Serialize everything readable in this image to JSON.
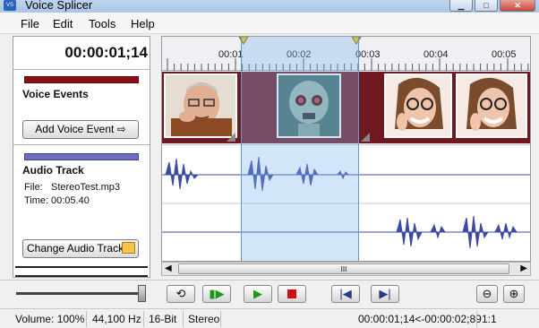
{
  "window": {
    "title": "Voice Splicer",
    "icon_name": "app-icon"
  },
  "menu": [
    "File",
    "Edit",
    "Tools",
    "Help"
  ],
  "left_panel": {
    "timecode": "00:00:01;14",
    "voice_events": {
      "title": "Voice Events",
      "button": "Add Voice Event",
      "button_icon": "arrow-right-icon"
    },
    "audio_track": {
      "title": "Audio Track",
      "file_label": "File:",
      "file_value": "StereoTest.mp3",
      "time_label": "Time:",
      "time_value": "00:05.40",
      "button": "Change Audio Track",
      "button_icon": "folder-icon"
    }
  },
  "timeline": {
    "ruler_labels": [
      "00:01",
      "00:02",
      "00:03",
      "00:04",
      "00:05"
    ],
    "clips": [
      {
        "name": "clip-old-man",
        "icon": "old-man-face"
      },
      {
        "name": "clip-alien",
        "icon": "alien-face"
      },
      {
        "name": "clip-woman-1",
        "icon": "woman-face"
      },
      {
        "name": "clip-woman-2",
        "icon": "woman-face"
      }
    ],
    "scrollbar_grip": "III"
  },
  "controls": {
    "volume_level": 1.0,
    "buttons": [
      "loop",
      "play-selection",
      "play",
      "stop",
      "go-to-start",
      "go-to-end",
      "zoom-out",
      "zoom-in"
    ]
  },
  "status": {
    "volume": "Volume: 100%",
    "rate": "44,100 Hz",
    "bits": "16-Bit",
    "channels": "Stereo",
    "range": "00:00:01;14<-00:00:02;89",
    "zoom": "1:1"
  },
  "colors": {
    "event_bar": "#8b0f14",
    "audio_bar": "#6c6fc0",
    "wave": "#3c4aa7",
    "selection": "#5b9bd5"
  }
}
